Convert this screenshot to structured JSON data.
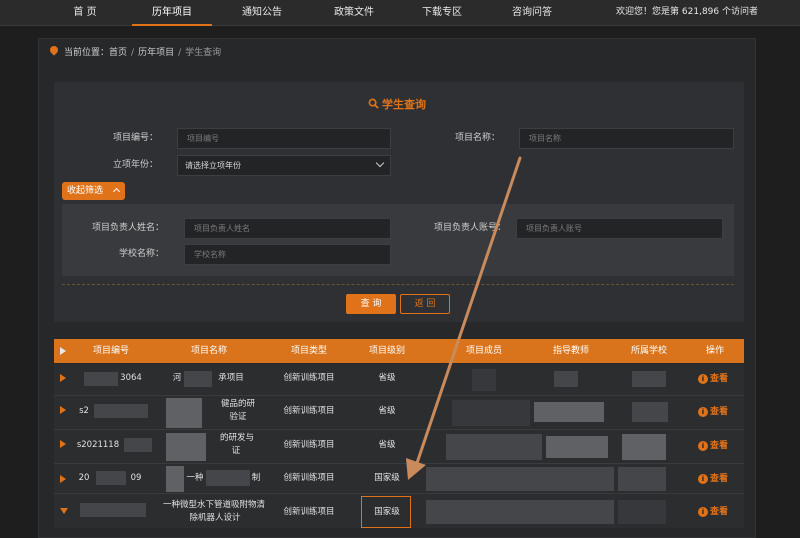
{
  "nav": {
    "items": [
      "首 页",
      "历年项目",
      "通知公告",
      "政策文件",
      "下载专区",
      "咨询问答"
    ],
    "active_index": 1,
    "visits_label": "欢迎您！您是第 621,896 个访问者"
  },
  "breadcrumb": {
    "prefix": "当前位置：",
    "home": "首页",
    "section": "历年项目",
    "current": "学生查询",
    "sep": "/"
  },
  "search": {
    "title": "学生查询",
    "fields": {
      "project_no_label": "项目编号：",
      "project_no_placeholder": "项目编号",
      "project_name_label": "项目名称：",
      "project_name_placeholder": "项目名称",
      "year_label": "立项年份：",
      "year_value": "请选择立项年份",
      "leader_name_label": "项目负责人姓名：",
      "leader_name_placeholder": "项目负责人姓名",
      "leader_account_label": "项目负责人账号：",
      "leader_account_placeholder": "项目负责人账号",
      "school_label": "学校名称：",
      "school_placeholder": "学校名称"
    },
    "collapse_label": "收起筛选",
    "query_label": "查 询",
    "back_label": "返 回"
  },
  "table": {
    "headers": [
      "项目编号",
      "项目名称",
      "项目类型",
      "项目级别",
      "项目成员",
      "指导教师",
      "所属学校",
      "操作"
    ],
    "rows": [
      {
        "no": "3064",
        "name_a": "河",
        "name_b": "承项目",
        "type": "创新训练项目",
        "level": "省级",
        "action": "查看"
      },
      {
        "no": "s2",
        "name_a": "健品的研",
        "name_b": "验证",
        "type": "创新训练项目",
        "level": "省级",
        "action": "查看"
      },
      {
        "no": "s2021118",
        "name_a": "的研发与",
        "name_b": "证",
        "type": "创新训练项目",
        "level": "省级",
        "action": "查看"
      },
      {
        "no": "20",
        "no_b": "09",
        "name_a": "一种",
        "name_b": "制",
        "type": "创新训练项目",
        "level": "国家级",
        "action": "查看"
      },
      {
        "no": "",
        "name_a": "一种微型水下管道吸附物清",
        "name_b": "除机器人设计",
        "type": "创新训练项目",
        "level": "国家级",
        "action": "查看"
      }
    ]
  },
  "colors": {
    "accent": "#e0731a",
    "header_bg": "#d9741c",
    "page_bg": "#1e1e1f"
  }
}
